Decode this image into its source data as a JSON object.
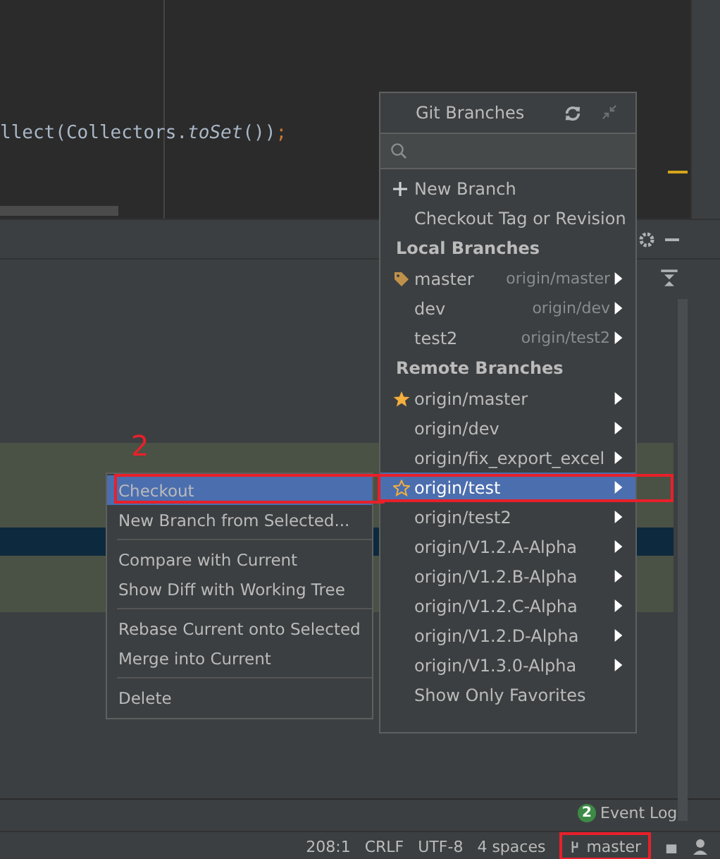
{
  "editor": {
    "code_tokens": [
      {
        "text": "llect(Collectors.",
        "kind": "plain"
      },
      {
        "text": "toSet",
        "kind": "italic"
      },
      {
        "text": "())",
        "kind": "plain"
      },
      {
        "text": ";",
        "kind": "keyword"
      }
    ]
  },
  "git_branches": {
    "title": "Git Branches",
    "items": [
      {
        "kind": "create",
        "label": "New Branch"
      },
      {
        "kind": "action",
        "label": "Checkout Tag or Revision"
      },
      {
        "kind": "header",
        "label": "Local Branches"
      },
      {
        "kind": "branch",
        "label": "master",
        "tracking": "origin/master",
        "current": true,
        "favorite": false,
        "selected": false
      },
      {
        "kind": "branch",
        "label": "dev",
        "tracking": "origin/dev",
        "current": false,
        "favorite": false,
        "selected": false
      },
      {
        "kind": "branch",
        "label": "test2",
        "tracking": "origin/test2",
        "current": false,
        "favorite": false,
        "selected": false
      },
      {
        "kind": "header",
        "label": "Remote Branches"
      },
      {
        "kind": "branch",
        "label": "origin/master",
        "current": false,
        "favorite": true,
        "selected": false
      },
      {
        "kind": "branch",
        "label": "origin/dev",
        "current": false,
        "favorite": false,
        "selected": false
      },
      {
        "kind": "branch",
        "label": "origin/fix_export_excel",
        "current": false,
        "favorite": false,
        "selected": false
      },
      {
        "kind": "branch",
        "label": "origin/test",
        "current": false,
        "favorite": false,
        "selected": true
      },
      {
        "kind": "branch",
        "label": "origin/test2",
        "current": false,
        "favorite": false,
        "selected": false
      },
      {
        "kind": "branch",
        "label": "origin/V1.2.A-Alpha",
        "current": false,
        "favorite": false,
        "selected": false
      },
      {
        "kind": "branch",
        "label": "origin/V1.2.B-Alpha",
        "current": false,
        "favorite": false,
        "selected": false
      },
      {
        "kind": "branch",
        "label": "origin/V1.2.C-Alpha",
        "current": false,
        "favorite": false,
        "selected": false
      },
      {
        "kind": "branch",
        "label": "origin/V1.2.D-Alpha",
        "current": false,
        "favorite": false,
        "selected": false
      },
      {
        "kind": "branch",
        "label": "origin/V1.3.0-Alpha",
        "current": false,
        "favorite": false,
        "selected": false
      },
      {
        "kind": "action",
        "label": "Show Only Favorites"
      }
    ]
  },
  "context_menu": {
    "groups": [
      [
        {
          "label": "Checkout",
          "selected": true
        },
        {
          "label": "New Branch from Selected...",
          "selected": false
        }
      ],
      [
        {
          "label": "Compare with Current",
          "selected": false
        },
        {
          "label": "Show Diff with Working Tree",
          "selected": false
        }
      ],
      [
        {
          "label": "Rebase Current onto Selected",
          "selected": false
        },
        {
          "label": "Merge into Current",
          "selected": false
        }
      ],
      [
        {
          "label": "Delete",
          "selected": false
        }
      ]
    ]
  },
  "annotations": [
    {
      "text": "2"
    }
  ],
  "status_bar": {
    "event_log": {
      "label": "Event Log",
      "badge": "2"
    },
    "items": [
      "208:1",
      "CRLF",
      "UTF-8",
      "4 spaces"
    ],
    "branch": "master"
  }
}
